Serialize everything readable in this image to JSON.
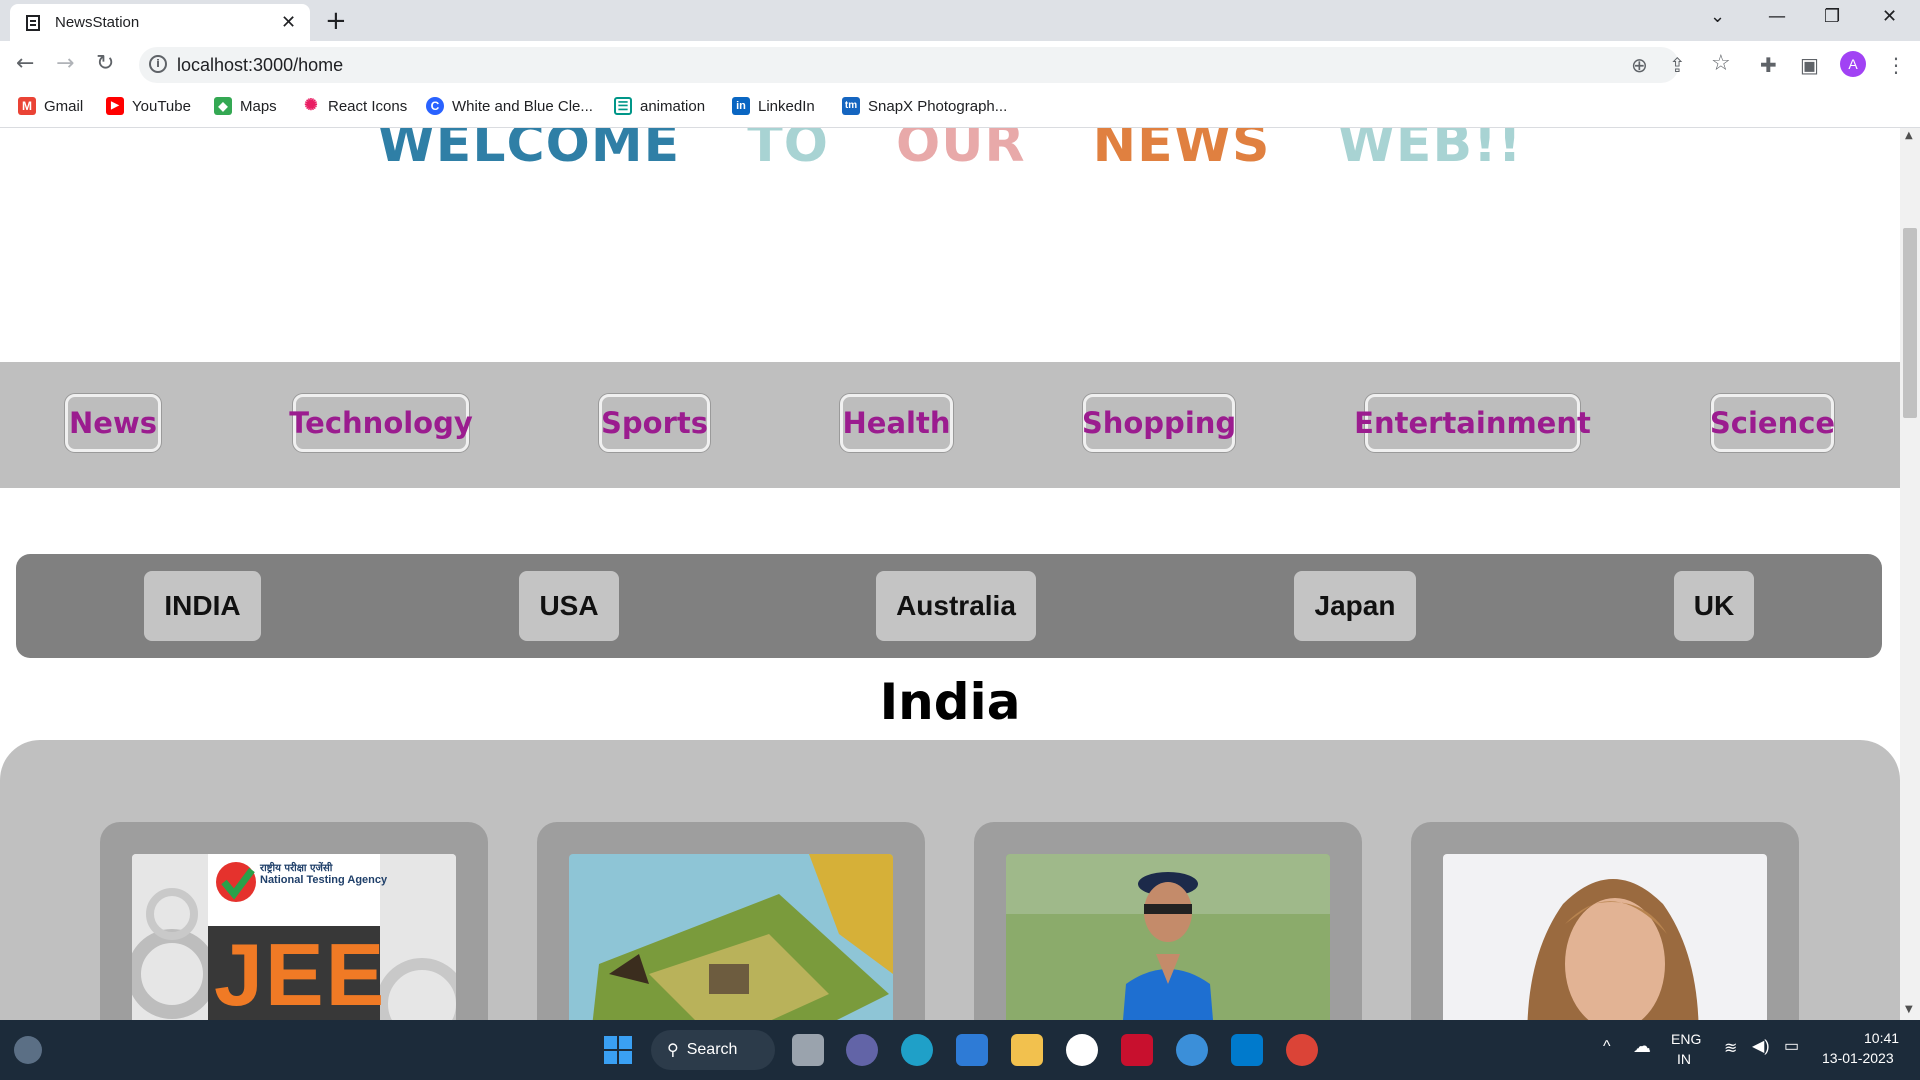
{
  "browser": {
    "tab_title": "NewsStation",
    "url": "localhost:3000/home",
    "avatar_letter": "A",
    "bookmarks": [
      {
        "label": "Gmail",
        "icon": "gmail-icon",
        "color": "#ea4335",
        "glyph": "M"
      },
      {
        "label": "YouTube",
        "icon": "youtube-icon",
        "color": "#ff0000",
        "glyph": "▶"
      },
      {
        "label": "Maps",
        "icon": "maps-icon",
        "color": "#34a853",
        "glyph": "◆"
      },
      {
        "label": "React Icons",
        "icon": "react-icon",
        "color": "#e91e63",
        "glyph": "✺"
      },
      {
        "label": "White and Blue Cle...",
        "icon": "canva-icon",
        "color": "#2962ff",
        "glyph": "C"
      },
      {
        "label": "animation",
        "icon": "animation-icon",
        "color": "#009688",
        "glyph": "☰"
      },
      {
        "label": "LinkedIn",
        "icon": "linkedin-icon",
        "color": "#0a66c2",
        "glyph": "in"
      },
      {
        "label": "SnapX Photograph...",
        "icon": "snapx-icon",
        "color": "#1565c0",
        "glyph": "tm"
      }
    ]
  },
  "page": {
    "welcome_words": [
      {
        "text": "WELCOME",
        "color": "#2f7fa6"
      },
      {
        "text": "TO",
        "color": "#a8d3d3"
      },
      {
        "text": "OUR",
        "color": "#e8a9a9"
      },
      {
        "text": "NEWS",
        "color": "#e08040"
      },
      {
        "text": "WEB!!",
        "color": "#a8d3d3"
      }
    ],
    "categories": [
      "News",
      "Technology",
      "Sports",
      "Health",
      "Shopping",
      "Entertainment",
      "Science"
    ],
    "countries": [
      "INDIA",
      "USA",
      "Australia",
      "Japan",
      "UK"
    ],
    "selected_country_title": "India",
    "cards": [
      {
        "label": "jee-news-image",
        "text_top": "राष्ट्रीय परीक्षा एजेंसी",
        "text_mid": "National Testing Agency",
        "text_big": "JEE"
      },
      {
        "label": "game-news-image"
      },
      {
        "label": "cricket-news-image"
      },
      {
        "label": "celebrity-news-image"
      }
    ],
    "accent_color": "#9b1c8f"
  },
  "taskbar": {
    "search_label": "Search",
    "lang_top": "ENG",
    "lang_bottom": "IN",
    "time": "10:41",
    "date": "13-01-2023"
  }
}
